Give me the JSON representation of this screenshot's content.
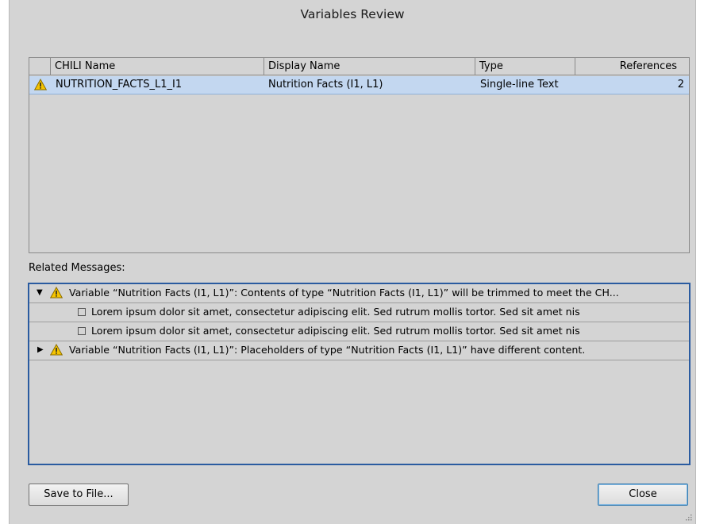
{
  "dialog": {
    "title": "Variables Review"
  },
  "table": {
    "columns": [
      "CHILI Name",
      "Display Name",
      "Type",
      "References"
    ],
    "rows": [
      {
        "chili_name": "NUTRITION_FACTS_L1_I1",
        "display_name": "Nutrition Facts (I1, L1)",
        "type": "Single-line Text",
        "references": "2",
        "status_icon": "warning-icon"
      }
    ]
  },
  "messages": {
    "label": "Related Messages:",
    "items": [
      {
        "text": "Variable “Nutrition Facts (I1, L1)”: Contents of type “Nutrition Facts (I1, L1)” will be trimmed to meet the CH...",
        "expanded": true,
        "icon": "warning-icon"
      },
      {
        "text": "Lorem ipsum dolor sit amet, consectetur adipiscing elit. Sed rutrum mollis tortor. Sed sit amet nis",
        "icon": "frame-icon"
      },
      {
        "text": "Lorem ipsum dolor sit amet, consectetur adipiscing elit. Sed rutrum mollis tortor. Sed sit amet nis",
        "icon": "frame-icon"
      },
      {
        "text": "Variable “Nutrition Facts (I1, L1)”: Placeholders of type “Nutrition Facts (I1, L1)” have different content.",
        "expanded": false,
        "icon": "warning-icon"
      }
    ]
  },
  "buttons": {
    "save": "Save to File...",
    "close": "Close"
  },
  "colors": {
    "selection": "#c3d7f0",
    "focus_border": "#2a5ba0",
    "warning": "#f5c400"
  }
}
